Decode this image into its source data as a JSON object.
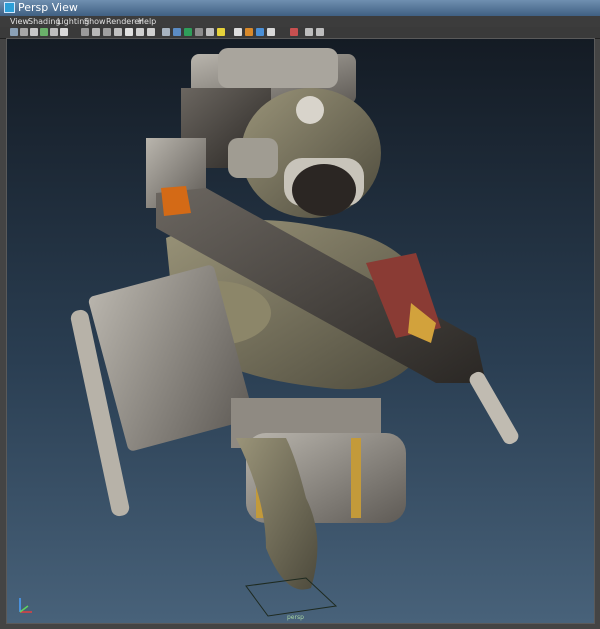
{
  "window": {
    "title": "Persp View",
    "icon": "maya-window-icon"
  },
  "menu": [
    {
      "label": "View"
    },
    {
      "label": "Shading"
    },
    {
      "label": "Lighting"
    },
    {
      "label": "Show"
    },
    {
      "label": "Renderer"
    },
    {
      "label": "Help"
    }
  ],
  "toolbar": {
    "icons": [
      "camera-select-icon",
      "camera-attributes-icon",
      "bookmark-icon",
      "image-plane-icon",
      "two-d-pan-icon",
      "grease-pencil-icon",
      "grid-icon",
      "film-gate-icon",
      "resolution-gate-icon",
      "gate-mask-icon",
      "field-chart-icon",
      "safe-action-icon",
      "safe-title-icon",
      "wireframe-icon",
      "smooth-shade-icon",
      "wireframe-on-shaded-icon",
      "textured-icon",
      "use-all-lights-icon",
      "shadows-icon",
      "screen-space-ao-icon",
      "motion-blur-icon",
      "anti-aliasing-icon",
      "isolate-select-icon",
      "xray-icon",
      "xray-joints-icon",
      "xray-components-icon"
    ]
  },
  "viewport": {
    "camera_label": "persp"
  },
  "colors": {
    "accent_blue": "#2d9fd8",
    "viewport_top": "#141b24",
    "viewport_bottom": "#48627a"
  }
}
